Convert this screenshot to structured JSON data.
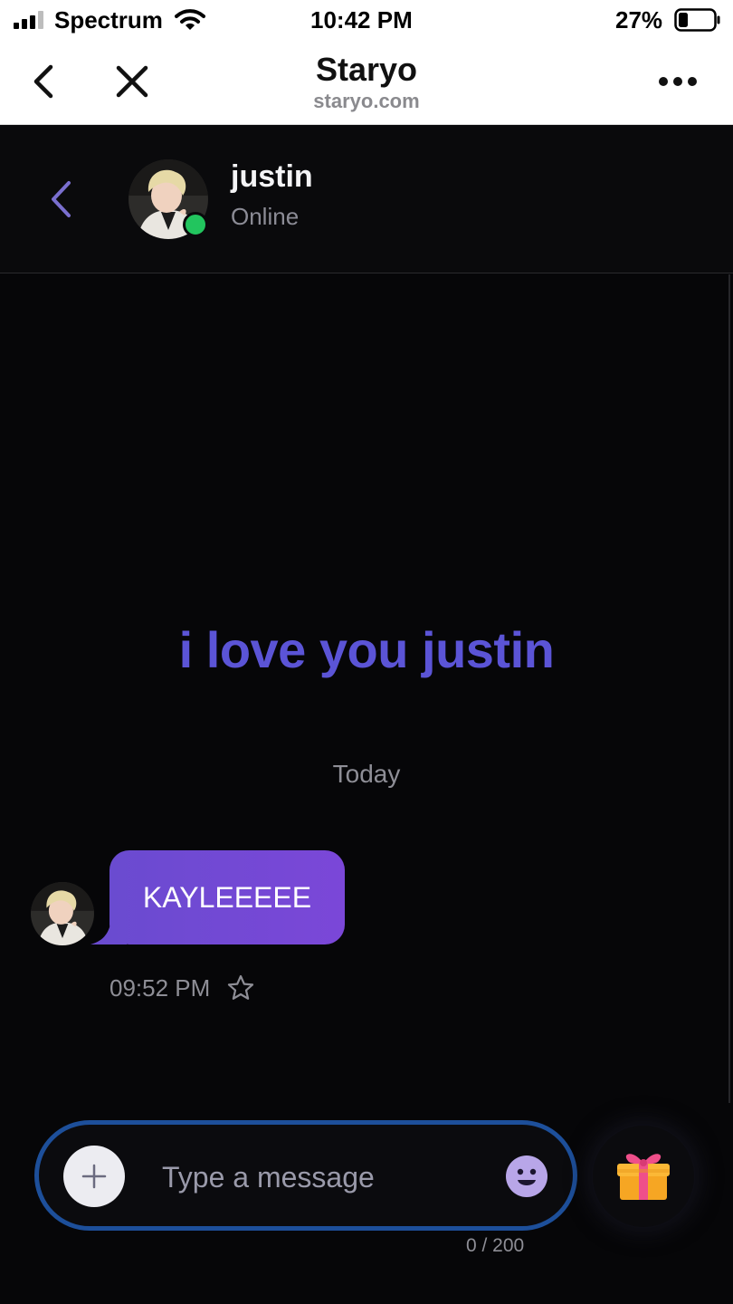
{
  "status_bar": {
    "carrier": "Spectrum",
    "time": "10:42 PM",
    "battery_percent": "27%",
    "battery_level": 0.27,
    "icons": [
      "signal-icon",
      "wifi-icon",
      "battery-icon"
    ]
  },
  "browser": {
    "title": "Staryo",
    "url": "staryo.com",
    "icons": [
      "back-arrow-icon",
      "close-icon",
      "more-dots-icon"
    ]
  },
  "chat": {
    "contact_name": "justin",
    "contact_status": "Online",
    "online_color": "#22c55e",
    "bio": "i love you justin",
    "date_divider": "Today",
    "messages": [
      {
        "text": "KAYLEEEEE",
        "time": "09:52 PM",
        "sender": "justin"
      }
    ]
  },
  "composer": {
    "placeholder": "Type a message",
    "char_count": "0 / 200",
    "icons": [
      "plus-icon",
      "emoji-icon",
      "gift-icon"
    ]
  },
  "colors": {
    "accent": "#5b54d6",
    "bubble_start": "#6a4bd0",
    "bubble_end": "#7b47d8",
    "composer_border": "#1d4f9a",
    "background": "#060608"
  }
}
